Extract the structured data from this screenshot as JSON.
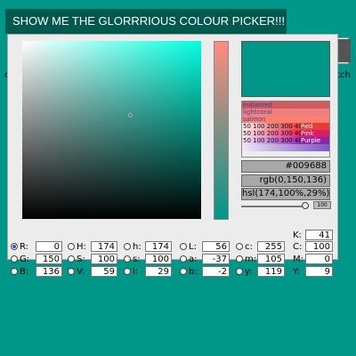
{
  "page": {
    "background": "#009688",
    "bg_text_left": "c",
    "bg_text_right": "atch"
  },
  "trigger": {
    "label": "SHOW ME THE GLORRRIOUS COLOUR PICKER!!!"
  },
  "picker": {
    "current_color": "#009688",
    "palette": {
      "names": [
        "indianred",
        "lightcoral",
        "salmon"
      ],
      "scales": [
        {
          "steps": "50 100 200 300 400",
          "name": "Red"
        },
        {
          "steps": "50 100 200 300 400",
          "name": "Pink"
        },
        {
          "steps": "50 100 200 300 400",
          "name": "Purple"
        }
      ]
    },
    "hex": "#009688",
    "rgb": "rgb(0,150,136)",
    "hsl": "hsl(174,100%,29%)",
    "alpha": {
      "level": 1,
      "label": "100"
    },
    "fields": {
      "R": "0",
      "G": "150",
      "B": "136",
      "H": "174",
      "S": "100",
      "V": "59",
      "h": "174",
      "s": "100",
      "l": "29",
      "L": "56",
      "a": "-37",
      "b": "-2",
      "c": "255",
      "m": "105",
      "y": "119",
      "K": "41",
      "C": "100",
      "M": "0",
      "Y": "9"
    },
    "labels": {
      "R": "R:",
      "G": "G:",
      "B": "B:",
      "H": "H:",
      "S": "S:",
      "V": "V:",
      "h": "h:",
      "s": "s:",
      "l": "l:",
      "L": "L:",
      "a": "a:",
      "b": "b:",
      "c": "c:",
      "m": "m:",
      "y": "y:",
      "K": "K:",
      "C": "C:",
      "M": "M:",
      "Y": "Y:"
    },
    "selected_mode": "R"
  }
}
